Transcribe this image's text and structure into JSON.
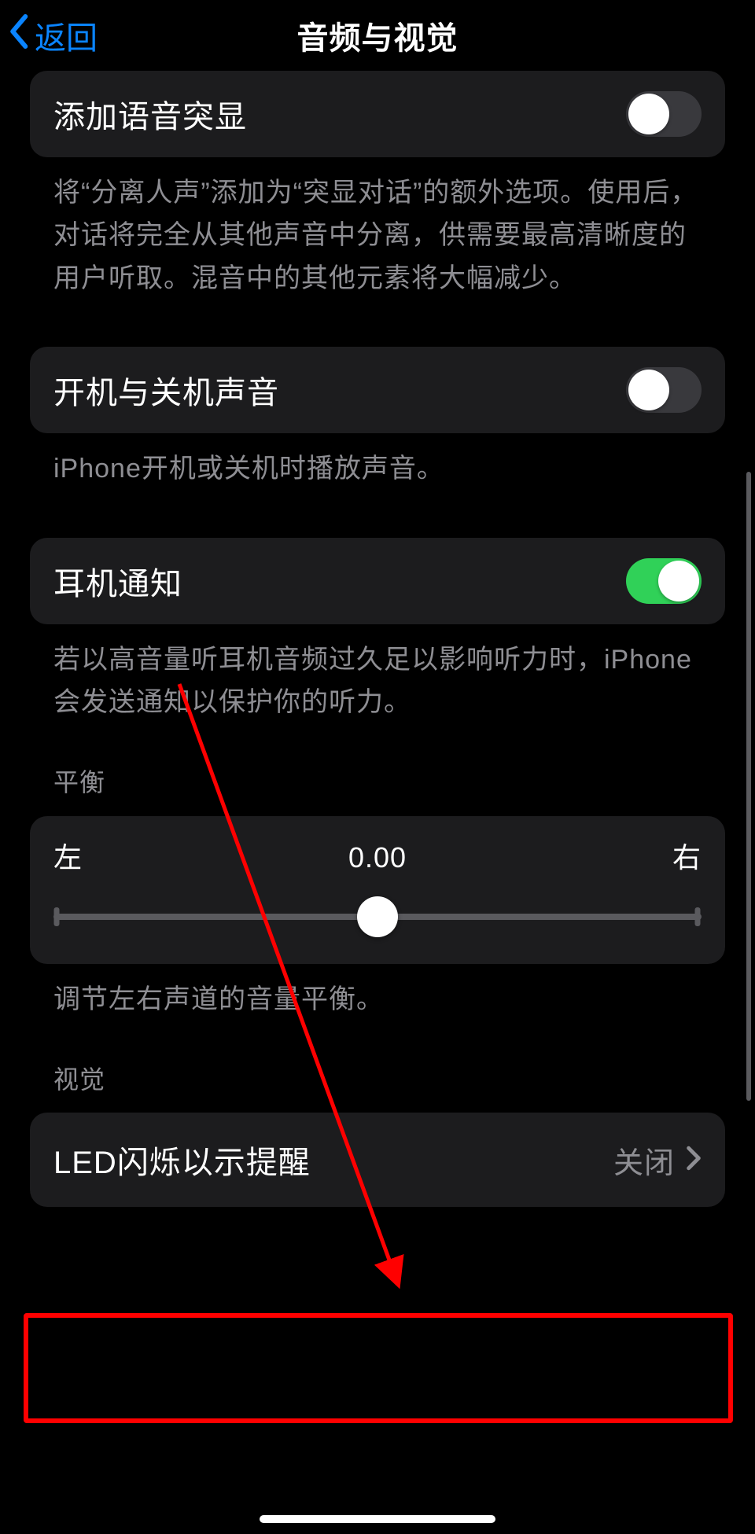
{
  "nav": {
    "back_label": "返回",
    "title": "音频与视觉"
  },
  "rows": {
    "voice_isolation": {
      "label": "添加语音突显",
      "on": false,
      "footer": "将“分离人声”添加为“突显对话”的额外选项。使用后，对话将完全从其他声音中分离，供需要最高清晰度的用户听取。混音中的其他元素将大幅减少。"
    },
    "power_sound": {
      "label": "开机与关机声音",
      "on": false,
      "footer": "iPhone开机或关机时播放声音。"
    },
    "headphone_notify": {
      "label": "耳机通知",
      "on": true,
      "footer": "若以高音量听耳机音频过久足以影响听力时，iPhone会发送通知以保护你的听力。"
    }
  },
  "balance": {
    "header": "平衡",
    "left": "左",
    "right": "右",
    "value": "0.00",
    "footer": "调节左右声道的音量平衡。"
  },
  "visual": {
    "header": "视觉",
    "led_row": {
      "label": "LED闪烁以示提醒",
      "value": "关闭"
    }
  },
  "colors": {
    "accent_blue": "#0a84ff",
    "toggle_green": "#30d158",
    "cell_bg": "#1c1c1e",
    "secondary_text": "#8e8e93",
    "annotation_red": "#ff0000"
  }
}
